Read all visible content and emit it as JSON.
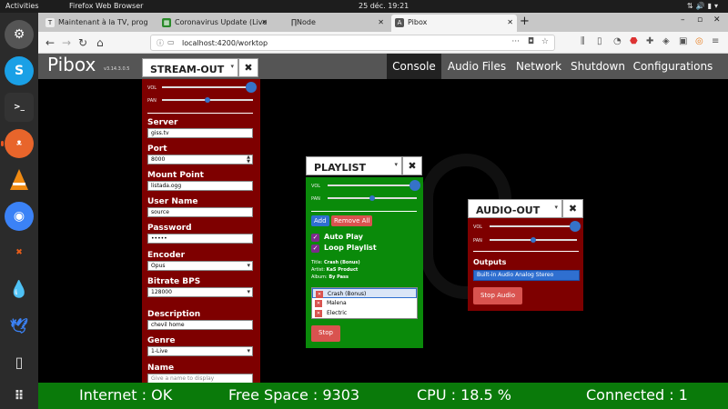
{
  "topbar": {
    "activities": "Activities",
    "app": "Firefox Web Browser",
    "clock": "25 déc.  19:21",
    "tray_icons": [
      "network-icon",
      "volume-icon",
      "battery-icon",
      "menu-icon"
    ]
  },
  "dock": {
    "apps": [
      "settings",
      "skype",
      "terminal",
      "firefox",
      "vlc",
      "chromium",
      "crossover",
      "drop",
      "bird",
      "usb-drive",
      "app-grid"
    ]
  },
  "browser": {
    "tabs": [
      {
        "title": "Maintenant à la TV, prog",
        "active": false
      },
      {
        "title": "Coronavirus Update (Live",
        "active": false
      },
      {
        "title": "∏Node",
        "active": false
      },
      {
        "title": "Pibox",
        "active": true
      }
    ],
    "new_tab": "+",
    "window_controls": [
      "–",
      "▫",
      "✕"
    ],
    "url": "localhost:4200/worktop"
  },
  "app": {
    "brand": "Pibox",
    "version": "v3.14.3.0.5",
    "nav": [
      {
        "label": "Console",
        "active": true
      },
      {
        "label": "Audio Files",
        "active": false
      },
      {
        "label": "Network",
        "active": false
      },
      {
        "label": "Shutdown",
        "active": false
      },
      {
        "label": "Configurations",
        "active": false
      }
    ]
  },
  "stream_out": {
    "title": "STREAM-OUT",
    "close": "✖",
    "vol_label": "VOL",
    "pan_label": "PAN",
    "vol_level": 0.98,
    "pan_level": 0.5,
    "fields": {
      "server_label": "Server",
      "server_value": "giss.tv",
      "port_label": "Port",
      "port_value": "8000",
      "mount_label": "Mount Point",
      "mount_value": "listada.ogg",
      "user_label": "User Name",
      "user_value": "source",
      "password_label": "Password",
      "password_value": "•••••",
      "encoder_label": "Encoder",
      "encoder_value": "Opus",
      "bitrate_label": "Bitrate BPS",
      "bitrate_value": "128000",
      "description_label": "Description",
      "description_value": "chevil home",
      "genre_label": "Genre",
      "genre_value": "1-Live",
      "name_label": "Name",
      "name_placeholder": "Give a name to display"
    }
  },
  "playlist": {
    "title": "PLAYLIST",
    "close": "✖",
    "vol_label": "VOL",
    "pan_label": "PAN",
    "vol_level": 0.98,
    "pan_level": 0.5,
    "add_label": "Add",
    "remove_all_label": "Remove All",
    "auto_play_label": "Auto Play",
    "loop_label": "Loop Playlist",
    "meta_title_label": "Title:",
    "meta_title": "Crash (Bonus)",
    "meta_artist_label": "Artist:",
    "meta_artist": "KaS Product",
    "meta_album_label": "Album:",
    "meta_album": "By Pass",
    "items": [
      {
        "name": "Crash (Bonus)",
        "selected": true
      },
      {
        "name": "Malena",
        "selected": false
      },
      {
        "name": "Electric",
        "selected": false
      }
    ],
    "stop_label": "Stop"
  },
  "audio_out": {
    "title": "AUDIO-OUT",
    "close": "✖",
    "vol_label": "VOL",
    "pan_label": "PAN",
    "vol_level": 0.98,
    "pan_level": 0.5,
    "outputs_label": "Outputs",
    "outputs_value": "Built-in Audio Analog Stereo",
    "stop_label": "Stop Audio"
  },
  "status": {
    "internet": "Internet : OK",
    "free_space": "Free Space : 9303",
    "cpu": "CPU : 18.5 %",
    "connected": "Connected : 1"
  },
  "colors": {
    "stream_bg": "#7e0000",
    "playlist_bg": "#0a8a0a",
    "status_bg": "#0a7a0a",
    "accent": "#2f6fd0"
  }
}
